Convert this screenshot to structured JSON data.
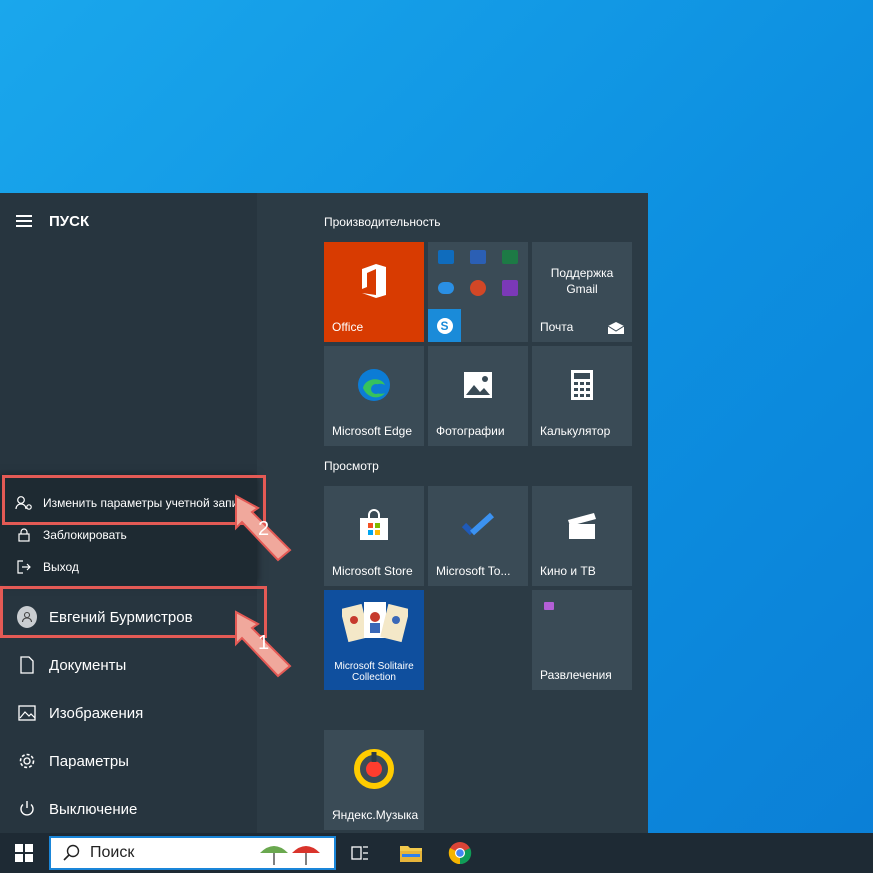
{
  "start": {
    "title": "ПУСК",
    "popup": {
      "change_account": "Изменить параметры учетной запис",
      "lock": "Заблокировать",
      "signout": "Выход"
    },
    "user_name": "Евгений Бурмистров",
    "nav": {
      "documents": "Документы",
      "pictures": "Изображения",
      "settings": "Параметры",
      "power": "Выключение"
    },
    "groups": {
      "productivity": "Производительность",
      "explore": "Просмотр"
    },
    "tiles": {
      "office": "Office",
      "mail_title": "Поддержка Gmail",
      "mail": "Почта",
      "edge": "Microsoft Edge",
      "photos": "Фотографии",
      "calculator": "Калькулятор",
      "store": "Microsoft Store",
      "todo": "Microsoft To...",
      "movies": "Кино и ТВ",
      "solitaire": "Microsoft Solitaire Collection",
      "entertainment": "Развлечения",
      "yandex_music": "Яндекс.Музыка"
    }
  },
  "annotations": {
    "step1": "1",
    "step2": "2"
  },
  "taskbar": {
    "search_placeholder": "Поиск"
  },
  "colors": {
    "accent_red": "#e45a55",
    "office_tile": "#d83b01",
    "desktop": "#1aa7ec"
  }
}
